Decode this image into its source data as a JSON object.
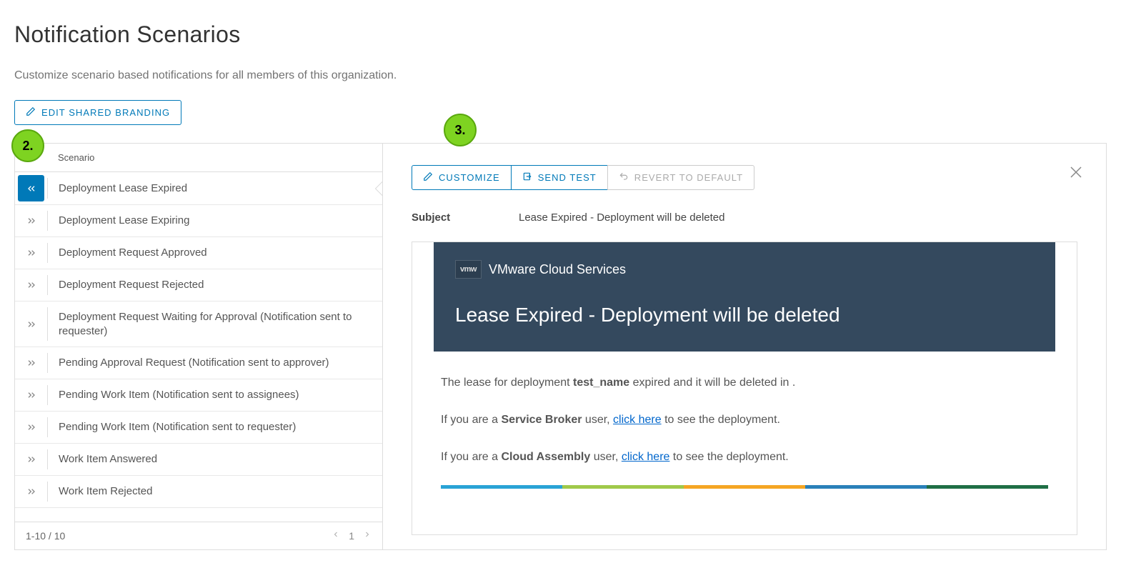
{
  "page": {
    "title": "Notification Scenarios",
    "subtitle": "Customize scenario based notifications for all members of this organization."
  },
  "actions": {
    "edit_branding": "EDIT SHARED BRANDING"
  },
  "list": {
    "header": "Scenario",
    "items": [
      {
        "label": "Deployment Lease Expired",
        "selected": true
      },
      {
        "label": "Deployment Lease Expiring"
      },
      {
        "label": "Deployment Request Approved"
      },
      {
        "label": "Deployment Request Rejected"
      },
      {
        "label": "Deployment Request Waiting for Approval (Notification sent to requester)"
      },
      {
        "label": "Pending Approval Request (Notification sent to approver)"
      },
      {
        "label": "Pending Work Item (Notification sent to assignees)"
      },
      {
        "label": "Pending Work Item (Notification sent to requester)"
      },
      {
        "label": "Work Item Answered"
      },
      {
        "label": "Work Item Rejected"
      }
    ],
    "footer": {
      "range": "1-10 / 10",
      "page": "1"
    }
  },
  "detail": {
    "toolbar": {
      "customize": "CUSTOMIZE",
      "send_test": "SEND TEST",
      "revert": "REVERT TO DEFAULT"
    },
    "subject_label": "Subject",
    "subject_value": "Lease Expired - Deployment will be deleted",
    "email": {
      "brand_logo_text": "vmw",
      "brand": "VMware Cloud Services",
      "title": "Lease Expired - Deployment will be deleted",
      "para1_a": "The lease for deployment ",
      "para1_bold": "test_name",
      "para1_b": " expired and it will be deleted in .",
      "para2_a": "If you are a ",
      "para2_bold": "Service Broker",
      "para2_b": " user, ",
      "para2_link": "click here",
      "para2_c": " to see the deployment.",
      "para3_a": "If you are a ",
      "para3_bold": "Cloud Assembly",
      "para3_b": " user, ",
      "para3_link": "click here",
      "para3_c": " to see the deployment.",
      "strip_colors": [
        "#29a3d6",
        "#a0c94a",
        "#f5a623",
        "#2980b9",
        "#1f6f45"
      ]
    }
  },
  "callouts": {
    "two": "2.",
    "three": "3."
  }
}
